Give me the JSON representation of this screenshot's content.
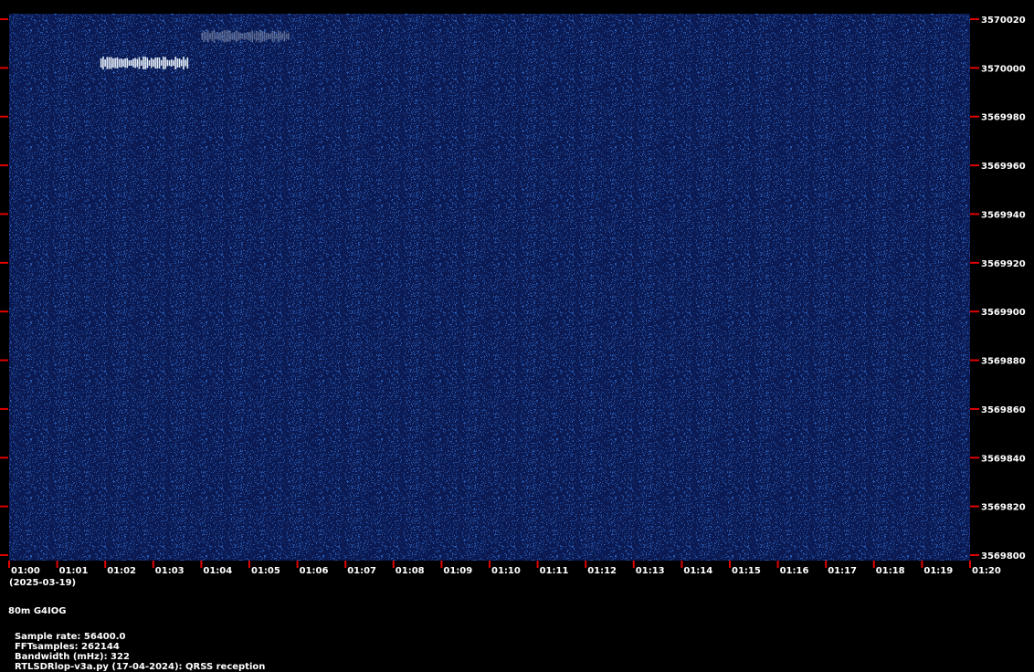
{
  "chart_data": {
    "type": "heatmap",
    "title": "",
    "xlabel": "",
    "ylabel": "",
    "x_ticks": [
      "01:00",
      "01:01",
      "01:02",
      "01:03",
      "01:04",
      "01:05",
      "01:06",
      "01:07",
      "01:08",
      "01:09",
      "01:10",
      "01:11",
      "01:12",
      "01:13",
      "01:14",
      "01:15",
      "01:16",
      "01:17",
      "01:18",
      "01:19",
      "01:20"
    ],
    "x_date": "(2025-03-19)",
    "y_ticks": [
      3570020,
      3570000,
      3569980,
      3569960,
      3569940,
      3569920,
      3569900,
      3569880,
      3569860,
      3569840,
      3569820,
      3569800
    ],
    "ylim": [
      3569800,
      3570020
    ],
    "xlim_minutes": [
      0,
      20
    ],
    "grid": false,
    "background_color": "#0b1a52",
    "noise_color": "#2b5fb8",
    "signal_color": "#e6eef8",
    "signals": [
      {
        "start_min": 1.9,
        "end_min": 3.7,
        "freq_hz": 3570002,
        "intensity": 1.0
      },
      {
        "start_min": 4.0,
        "end_min": 5.8,
        "freq_hz": 3570013,
        "intensity": 0.35
      }
    ]
  },
  "footer": {
    "station": "80m G4IOG",
    "sample_rate": "Sample rate: 56400.0",
    "fft_samples": "FFTsamples: 262144",
    "bandwidth": "Bandwidth (mHz): 322",
    "software": "RTLSDRlop-v3a.py (17-04-2024): QRSS reception"
  },
  "colors": {
    "tick_mark": "#e00000",
    "text": "#ffffff"
  }
}
